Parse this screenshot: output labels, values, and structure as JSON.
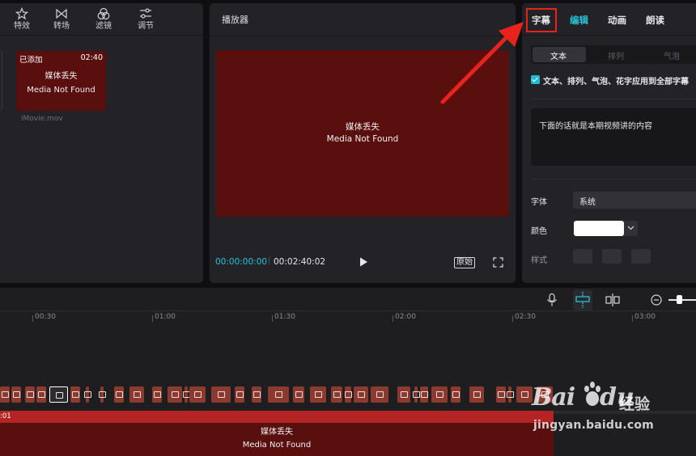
{
  "media_toolbar": {
    "items": [
      {
        "label": "特效",
        "icon": "effects-star-icon"
      },
      {
        "label": "转场",
        "icon": "transition-bowtie-icon"
      },
      {
        "label": "滤镜",
        "icon": "filter-circles-icon"
      },
      {
        "label": "调节",
        "icon": "adjust-sliders-icon"
      }
    ]
  },
  "media_card": {
    "added_label": "已添加",
    "duration": "02:40",
    "missing_cn": "媒体丢失",
    "missing_en": "Media Not Found",
    "filename": "iMovie.mov"
  },
  "player": {
    "title": "播放器",
    "missing_cn": "媒体丢失",
    "missing_en": "Media Not Found",
    "time_current": "00:00:00:00",
    "time_separator": "|",
    "time_total": "00:02:40:02",
    "ratio_label": "原始"
  },
  "properties": {
    "tabs": [
      "字幕",
      "编辑",
      "动画",
      "朗读"
    ],
    "active_tab": "编辑",
    "subtabs": [
      "文本",
      "排列",
      "气泡"
    ],
    "apply_all_label": "文本、排列、气泡、花字应用到全部字幕",
    "text_content": "下面的话就是本期视频讲的内容",
    "font_label": "字体",
    "font_value": "系统",
    "color_label": "颜色",
    "color_value": "#ffffff",
    "style_label": "样式"
  },
  "timeline": {
    "ruler": [
      "00:30",
      "01:00",
      "01:30",
      "02:00",
      "02:30",
      "03:00"
    ],
    "main_clip_time": ":01",
    "missing_cn": "媒体丢失",
    "missing_en": "Media Not Found"
  },
  "annotation": {
    "highlight_color": "#e8231e"
  },
  "watermark": {
    "brand_bai": "Bai",
    "brand_du": "du",
    "brand_cn": "经验",
    "url": "jingyan.baidu.com"
  }
}
